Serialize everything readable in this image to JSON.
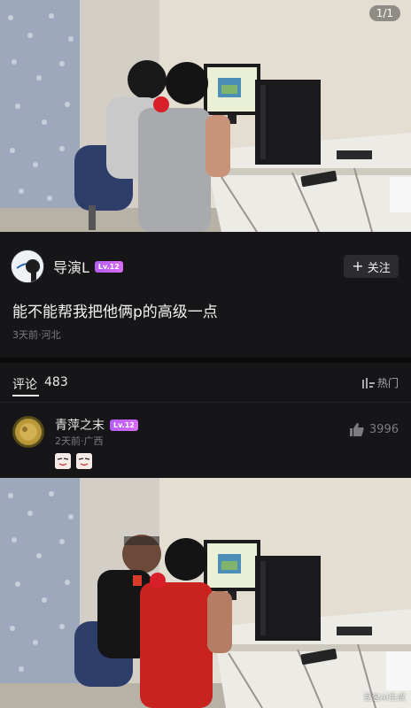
{
  "gallery": {
    "counter": "1/1"
  },
  "post": {
    "author": "导演L",
    "level": "Lv.12",
    "follow_label": "关注",
    "text": "能不能帮我把他俩p的高级一点",
    "meta": "3天前·河北"
  },
  "comments": {
    "label": "评论",
    "count": "483",
    "sort_label": "热门",
    "items": [
      {
        "name": "青萍之末",
        "level": "Lv.12",
        "meta": "2天前·广西",
        "likes": "3996"
      }
    ]
  },
  "result_image": {
    "watermark": "豆包AI生成"
  },
  "colors": {
    "background": "#161618",
    "level_badge": "#c765f4",
    "follow_button": "#2c2c30"
  },
  "icons": [
    "plus-icon",
    "sort-icon",
    "thumbs-up-icon"
  ]
}
